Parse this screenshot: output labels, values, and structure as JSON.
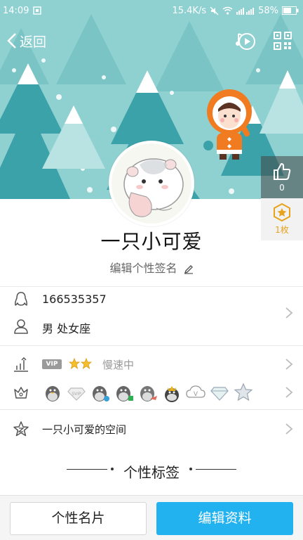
{
  "status_bar": {
    "time": "14:09",
    "net_speed": "15.4K/s",
    "battery": "58%"
  },
  "nav": {
    "back_label": "返回",
    "music_icon": "music-icon",
    "qr_icon": "qr-code-icon"
  },
  "profile": {
    "nickname": "一只小可爱",
    "signature": "编辑个性签名",
    "like_count": "0",
    "medal_count": "1枚"
  },
  "info": {
    "qq_number": "166535357",
    "gender_zodiac": "男  处女座",
    "vip_tag": "VIP",
    "vip_status": "慢速中",
    "space_label": "一只小可爱的空间"
  },
  "tags": {
    "title": "个性标签"
  },
  "buttons": {
    "card_label": "个性名片",
    "edit_label": "编辑资料"
  },
  "colors": {
    "accent": "#21b2ef",
    "banner_bg": "#8fd0d1",
    "tree": "#3aa2a8",
    "medal": "#e8a21c"
  }
}
